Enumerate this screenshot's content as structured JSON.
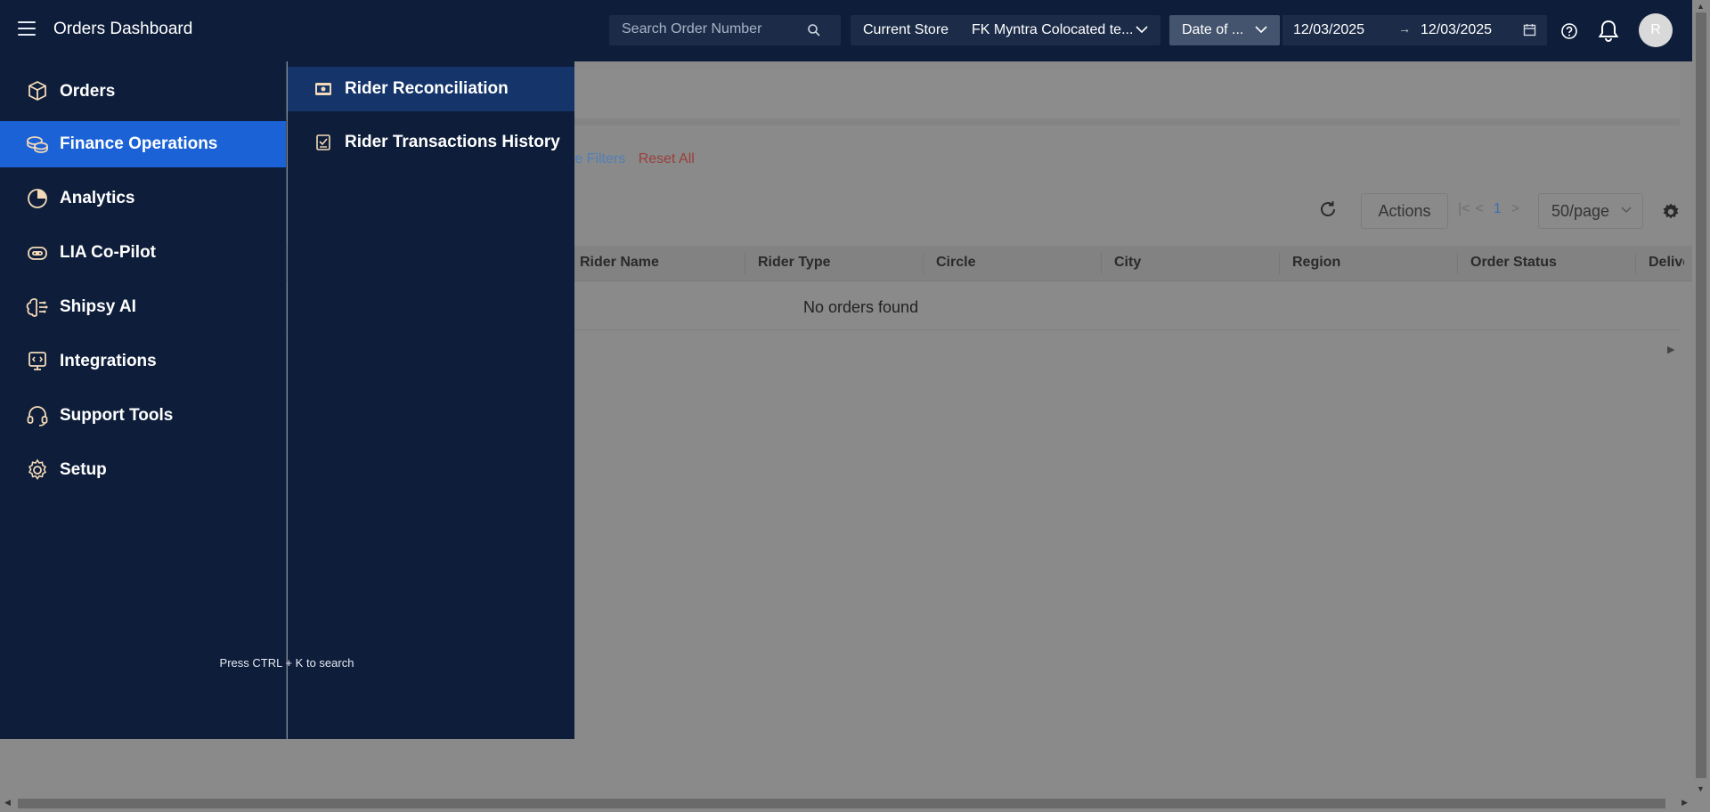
{
  "header": {
    "title": "Orders Dashboard",
    "search_placeholder": "Search Order Number",
    "store_label": "Current Store",
    "store_value": "FK Myntra Colocated te...",
    "date_type": "Date of ...",
    "date_from": "12/03/2025",
    "date_arrow": "→",
    "date_to": "12/03/2025",
    "avatar_initial": "R"
  },
  "sidebar": {
    "items": [
      {
        "label": "Orders",
        "icon": "box-icon"
      },
      {
        "label": "Finance Operations",
        "icon": "coins-icon",
        "active": true
      },
      {
        "label": "Analytics",
        "icon": "pie-chart-icon"
      },
      {
        "label": "LIA Co-Pilot",
        "icon": "robot-icon"
      },
      {
        "label": "Shipsy AI",
        "icon": "ai-brain-icon"
      },
      {
        "label": "Integrations",
        "icon": "integration-icon"
      },
      {
        "label": "Support Tools",
        "icon": "headset-icon"
      },
      {
        "label": "Setup",
        "icon": "gear-icon"
      }
    ],
    "search_hint": "Press CTRL + K to search"
  },
  "submenu": {
    "items": [
      {
        "label": "Rider Reconciliation",
        "icon": "money-icon",
        "active": true
      },
      {
        "label": "Rider Transactions History",
        "icon": "receipt-icon"
      }
    ]
  },
  "content": {
    "more_filters": "re Filters",
    "reset_all": "Reset All",
    "actions_label": "Actions",
    "page_number": "1",
    "page_size": "50/page",
    "columns": [
      "Rider Name",
      "Rider Type",
      "Circle",
      "City",
      "Region",
      "Order Status",
      "Deliver"
    ],
    "empty_message": "No orders found"
  },
  "colors": {
    "nav_bg": "#0e1e3a",
    "active_nav": "#1a62d6",
    "active_sub": "#14346a",
    "icon_accent": "#f3d9b8"
  }
}
